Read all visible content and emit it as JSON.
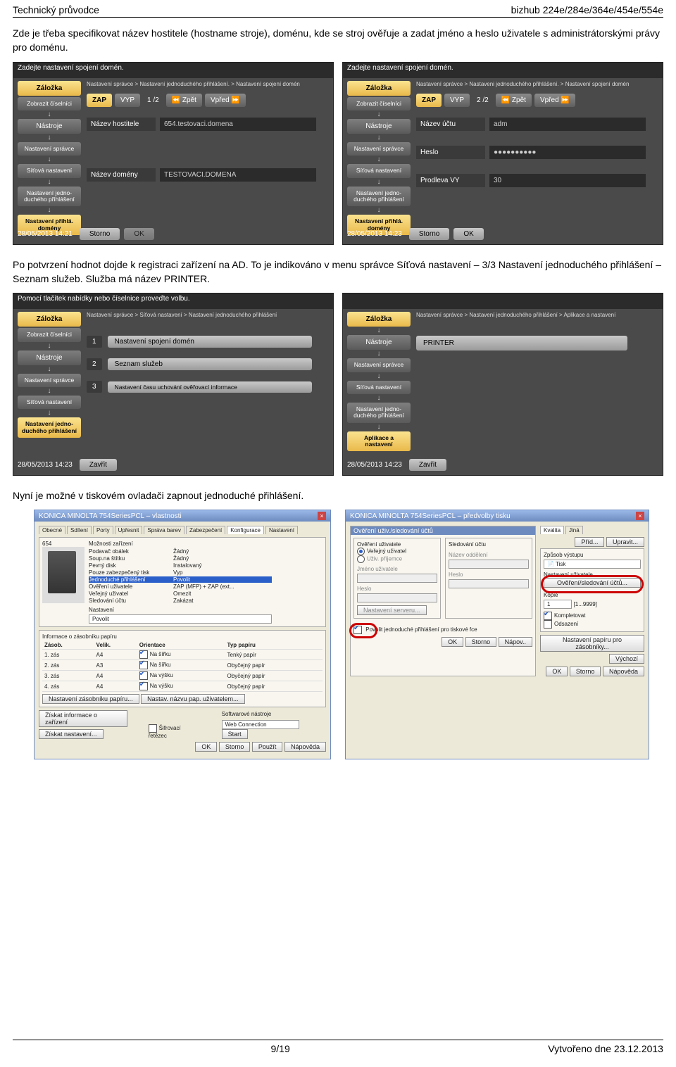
{
  "header": {
    "left": "Technický průvodce",
    "right": "bizhub 224e/284e/364e/454e/554e"
  },
  "para1": "Zde je třeba specifikovat název hostitele (hostname stroje), doménu, kde se stroj ověřuje a zadat jméno a heslo uživatele s administrátorskými právy pro doménu.",
  "mfp1": {
    "title": "Zadejte nastavení spojení domén.",
    "crumb": "Nastavení správce > Nastavení jednoduchého přihlášení. > Nastavení spojení domén",
    "side": [
      "Záložka",
      "Zobrazit číselníci",
      "Nástroje",
      "Nastavení správce",
      "Síťová nastavení",
      "Nastavení jedno-duchého přihlášení",
      "Nastavení přihlá. domény"
    ],
    "zap": "ZAP",
    "vyp": "VYP",
    "count": "1 /2",
    "zpet": "⏪ Zpět",
    "vpred": "Vpřed ⏩",
    "f1": {
      "label": "Název hostitele",
      "value": "654.testovaci.domena"
    },
    "f2": {
      "label": "Název domény",
      "value": "TESTOVACI.DOMENA"
    },
    "ts": "28/05/2013    14:21",
    "storno": "Storno",
    "ok": "OK"
  },
  "mfp2": {
    "title": "Zadejte nastavení spojení domén.",
    "crumb": "Nastavení správce > Nastaveni jednoduchého přihlášení. > Nastavení spojení domén",
    "count": "2 /2",
    "f1": {
      "label": "Název účtu",
      "value": "adm"
    },
    "f2": {
      "label": "Heslo",
      "value": "●●●●●●●●●●"
    },
    "f3": {
      "label": "Prodleva VY",
      "value": "30"
    },
    "ts": "28/05/2013    14:23"
  },
  "para2": "Po potvrzení hodnot dojde k registraci zařízení na AD. To je indikováno v menu správce Síťová nastavení – 3/3 Nastavení jednoduchého přihlášení – Seznam služeb. Služba má název PRINTER.",
  "mfp3": {
    "title": "Pomocí tlačítek nabídky nebo číselnice proveďte volbu.",
    "crumb": "Nastavení správce > Síťová nastavení > Nastavení jednoduchého přihlášení",
    "items": [
      {
        "num": "1",
        "label": "Nastavení spojení domén"
      },
      {
        "num": "2",
        "label": "Seznam služeb"
      },
      {
        "num": "3",
        "label": "Nastavení času uchování ověřovací informace"
      }
    ],
    "ts": "28/05/2013    14:23",
    "zavrit": "Zavřit"
  },
  "mfp4": {
    "crumb": "Nastavení správce > Nastavení jednoduchého přihlášení > Aplikace a nastavení",
    "app": "PRINTER",
    "sideLast": "Aplikace a nastavení",
    "ts": "28/05/2013    14:23",
    "zavrit": "Zavřit"
  },
  "para3": "Nyní je možné v tiskovém ovladači zapnout jednoduché přihlášení.",
  "win1": {
    "title": "KONICA MINOLTA 754SeriesPCL – vlastnosti",
    "tabs": [
      "Obecné",
      "Sdílení",
      "Porty",
      "Upřesnit",
      "Správa barev",
      "Zabezpečení",
      "Konfigurace",
      "Nastavení"
    ],
    "dev": "654",
    "opts_h": "Možnosti zařízení",
    "opts": [
      {
        "k": "Podavač obálek",
        "v": "Žádný"
      },
      {
        "k": "Soup.na štítku",
        "v": "Žádný"
      },
      {
        "k": "Pevný disk",
        "v": "Instalovaný"
      },
      {
        "k": "Pouze zabezpečený tisk",
        "v": "Vyp"
      },
      {
        "k": "Jednoduché přihlášení",
        "v": "Povolit",
        "hl": true
      },
      {
        "k": "Ověření uživatele",
        "v": "ZAP (MFP) + ZAP (ext..."
      },
      {
        "k": "Veřejný uživatel",
        "v": "Omezit"
      },
      {
        "k": "Sledování účtu",
        "v": "Zakázat"
      }
    ],
    "nast": "Nastavení",
    "povolit": "Povolit",
    "info_h": "Informace o zásobníku papíru",
    "cols": [
      "Zásob.",
      "Velik.",
      "Orientace",
      "Typ papíru"
    ],
    "rows": [
      [
        "1. zás",
        "A4",
        "Na šířku",
        "Tenký papír"
      ],
      [
        "2. zás",
        "A3",
        "Na šířku",
        "Obyčejný papír"
      ],
      [
        "3. zás",
        "A4",
        "Na výšku",
        "Obyčejný papír"
      ],
      [
        "4. zás",
        "A4",
        "Na výšku",
        "Obyčejný papír"
      ]
    ],
    "b1": "Nastavení zásobníku papíru...",
    "b2": "Nastav. názvu pap. uživatelem...",
    "b3": "Získat informace o zařízení",
    "l1": "Šifrovací řetězec",
    "l2": "Softwarové nástroje",
    "b4": "Získat nastavení...",
    "wc": "Web Connection",
    "start": "Start",
    "ok": "OK",
    "cancel": "Storno",
    "apply": "Použít",
    "help": "Nápověda"
  },
  "win2": {
    "title": "KONICA MINOLTA 754SeriesPCL – předvolby tisku",
    "topband": "Ověření uživ./sledování účtů",
    "left_h": "Ověření uživatele",
    "r1": "Veřejný uživatel",
    "r2": "Uživ. příjemce",
    "l_user": "Jméno uživatele",
    "l_pass": "Heslo",
    "b_srv": "Nastavení serveru...",
    "chk": "Povolit jednoduché přihlášení pro tiskové fce",
    "right_h": "Sledování účtu",
    "r_dept": "Název oddělení",
    "r_pass": "Heslo",
    "ok": "OK",
    "storno": "Storno",
    "napov": "Nápov..",
    "side": {
      "tabs": [
        "Kvalita",
        "Jiná"
      ],
      "prid": "Příd...",
      "upravit": "Upravit...",
      "outh": "Způsob výstupu",
      "tisk": "Tisk",
      "userh": "Nastavení uživatele",
      "hlbtn": "Ověření/sledování účtů...",
      "kopie": "Kopie",
      "kv": "1",
      "range": "[1...9999]",
      "komp": "Kompletovat",
      "odsaz": "Odsazení",
      "paper": "Nastavení papíru pro zásobníky...",
      "vych": "Výchozí",
      "ok2": "OK",
      "storn2": "Storno",
      "napov2": "Nápověda"
    }
  },
  "footer": {
    "left": "9/19",
    "right": "Vytvořeno dne 23.12.2013"
  }
}
